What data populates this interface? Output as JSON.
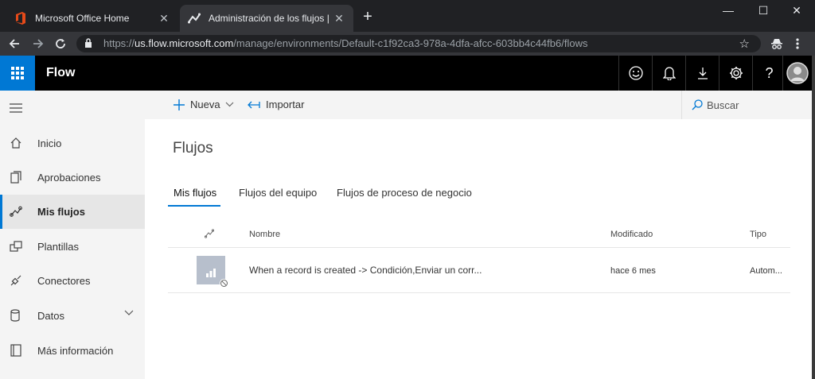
{
  "browser": {
    "tabs": [
      {
        "title": "Microsoft Office Home",
        "icon": "office-icon"
      },
      {
        "title": "Administración de los flujos | Mic",
        "icon": "flow-icon"
      }
    ],
    "url_prefix": "https://",
    "url_host": "us.flow.microsoft.com",
    "url_path": "/manage/environments/Default-c1f92ca3-978a-4dfa-afcc-603bb4c44fb6/flows"
  },
  "app": {
    "name": "Flow",
    "accent": "#0078d4"
  },
  "sidebar": {
    "items": [
      {
        "label": "Inicio",
        "icon": "home-icon"
      },
      {
        "label": "Aprobaciones",
        "icon": "approvals-icon"
      },
      {
        "label": "Mis flujos",
        "icon": "flow-icon",
        "active": true
      },
      {
        "label": "Plantillas",
        "icon": "templates-icon"
      },
      {
        "label": "Conectores",
        "icon": "connector-icon"
      },
      {
        "label": "Datos",
        "icon": "database-icon"
      },
      {
        "label": "Más información",
        "icon": "book-icon"
      }
    ]
  },
  "commandbar": {
    "new_label": "Nueva",
    "import_label": "Importar",
    "search_label": "Buscar"
  },
  "main": {
    "title": "Flujos",
    "tabs": [
      {
        "label": "Mis flujos",
        "active": true
      },
      {
        "label": "Flujos del equipo"
      },
      {
        "label": "Flujos de proceso de negocio"
      }
    ],
    "columns": {
      "name": "Nombre",
      "modified": "Modificado",
      "type": "Tipo"
    },
    "rows": [
      {
        "name": "When a record is created -> Condición,Enviar un corr...",
        "modified": "hace 6 mes",
        "type": "Autom..."
      }
    ]
  }
}
